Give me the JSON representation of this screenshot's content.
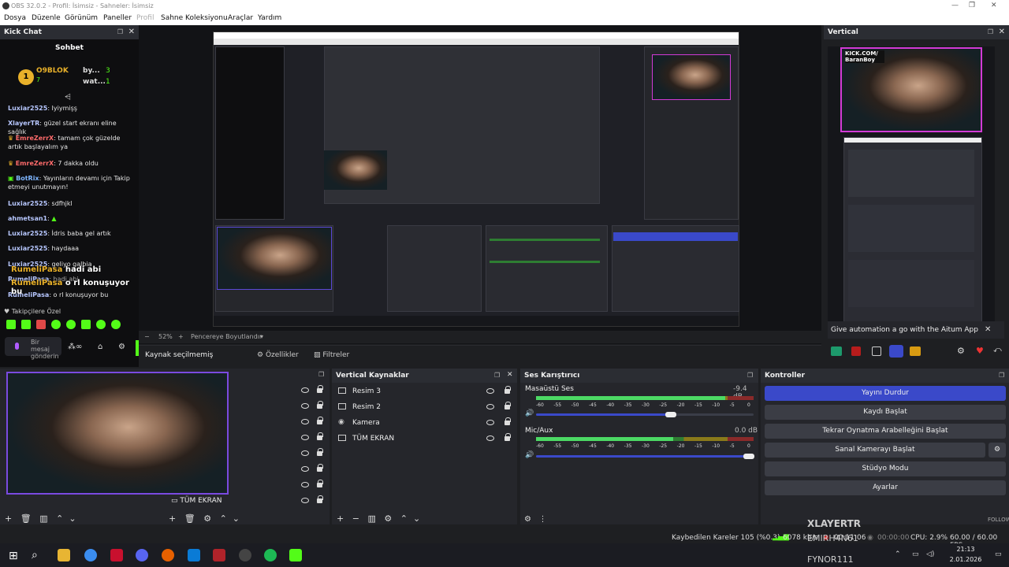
{
  "window": {
    "title": "OBS 32.0.2 - Profil: İsimsiz - Sahneler: İsimsiz",
    "min": "—",
    "max": "❐",
    "close": "✕"
  },
  "menu": [
    "Dosya",
    "Düzenle",
    "Görünüm",
    "Paneller",
    "Profil",
    "Sahne Koleksiyonu",
    "Araçlar",
    "Yardım"
  ],
  "chat": {
    "dock_title": "Kick Chat",
    "header": "Sohbet",
    "top_user": "O9BLOK",
    "top_user_count": "7",
    "top2": "by...",
    "top2_count": "3",
    "top3": "wat...",
    "top3_count": "1",
    "messages": [
      {
        "user": "Luxiar2525",
        "text": ": Iyiymişş"
      },
      {
        "user": "XlayerTR",
        "text": ": güzel start ekranı eline sağlık"
      },
      {
        "user": "EmreZerrX",
        "text": ": tamam çok güzelde artık başlayalım ya"
      },
      {
        "user": "EmreZerrX",
        "text": ": 7 dakka oldu"
      },
      {
        "user": "BotRix",
        "text": ": Yayınların devamı için Takip etmeyi unutmayın!"
      },
      {
        "user": "Luxiar2525",
        "text": ": sdfhjkl"
      },
      {
        "user": "ahmetsan1",
        "text": ":"
      },
      {
        "user": "Luxiar2525",
        "text": ": İdris baba gel artık"
      },
      {
        "user": "Luxiar2525",
        "text": ": haydaaa"
      },
      {
        "user": "Luxiar2525",
        "text": ": geliyo galbia"
      },
      {
        "user": "RumeliPasa",
        "text": ": hadi abi"
      },
      {
        "user": "RumeliPasa",
        "text": ": o rl konuşuyor bu"
      }
    ],
    "overlay1_user": "RumeliPasa",
    "overlay1_text": "hadi abi",
    "overlay2_user": "RumeliPasa",
    "overlay2_text": "o rl konuşuyor bu",
    "followers": "Takipçilere Özel",
    "send_placeholder": "Bir mesaj gönderin"
  },
  "preview": {
    "zoom": "52%",
    "fit": "Pencereye Boyutlandır"
  },
  "source_bar": {
    "selected": "Kaynak seçilmemiş",
    "properties": "Özellikler",
    "filters": "Filtreler"
  },
  "vertical": {
    "dock_title": "Vertical",
    "kick_text": "KICK.COM/\nBaranBoy",
    "aitum": "Give automation a go with the Aitum App"
  },
  "scene_preview": {
    "label": "TÜM EKRAN"
  },
  "vertical_sources": {
    "title": "Vertical Kaynaklar",
    "items": [
      "Resim 3",
      "Resim 2",
      "Kamera",
      "TÜM EKRAN"
    ]
  },
  "mixer": {
    "title": "Ses Karıştırıcı",
    "channels": [
      {
        "name": "Masaüstü Ses",
        "db": "-9.4 dB",
        "level": 0.87,
        "volume": 0.62
      },
      {
        "name": "Mic/Aux",
        "db": "0.0 dB",
        "level": 0.63,
        "volume": 0.98
      }
    ],
    "ticks": [
      "-60",
      "-55",
      "-50",
      "-45",
      "-40",
      "-35",
      "-30",
      "-25",
      "-20",
      "-15",
      "-10",
      "-5",
      "0"
    ]
  },
  "controls": {
    "title": "Kontroller",
    "buttons": [
      "Yayını Durdur",
      "Kaydı Başlat",
      "Tekrar Oynatma Arabelleğini Başlat",
      "Sanal Kamerayı Başlat",
      "Stüdyo Modu",
      "Ayarlar"
    ]
  },
  "status": {
    "dropped": "Kaybedilen Kareler 105 (%0.3)",
    "kbps": "6078 kb/s",
    "stream_time": "00:11:06",
    "rec_time": "00:00:00",
    "cpu": "CPU: 2.9%",
    "fps": "60.00 / 60.00 FPS"
  },
  "overlay_names": {
    "n1": "XLAYERTR",
    "n2": "EMIRH4N61",
    "n3": "FYNOR111",
    "follow": "FOLLOW"
  },
  "clock": {
    "time": "21:13",
    "date": "2.01.2026"
  },
  "colors": {
    "accent": "#3a49c9",
    "live": "#53fc18"
  }
}
